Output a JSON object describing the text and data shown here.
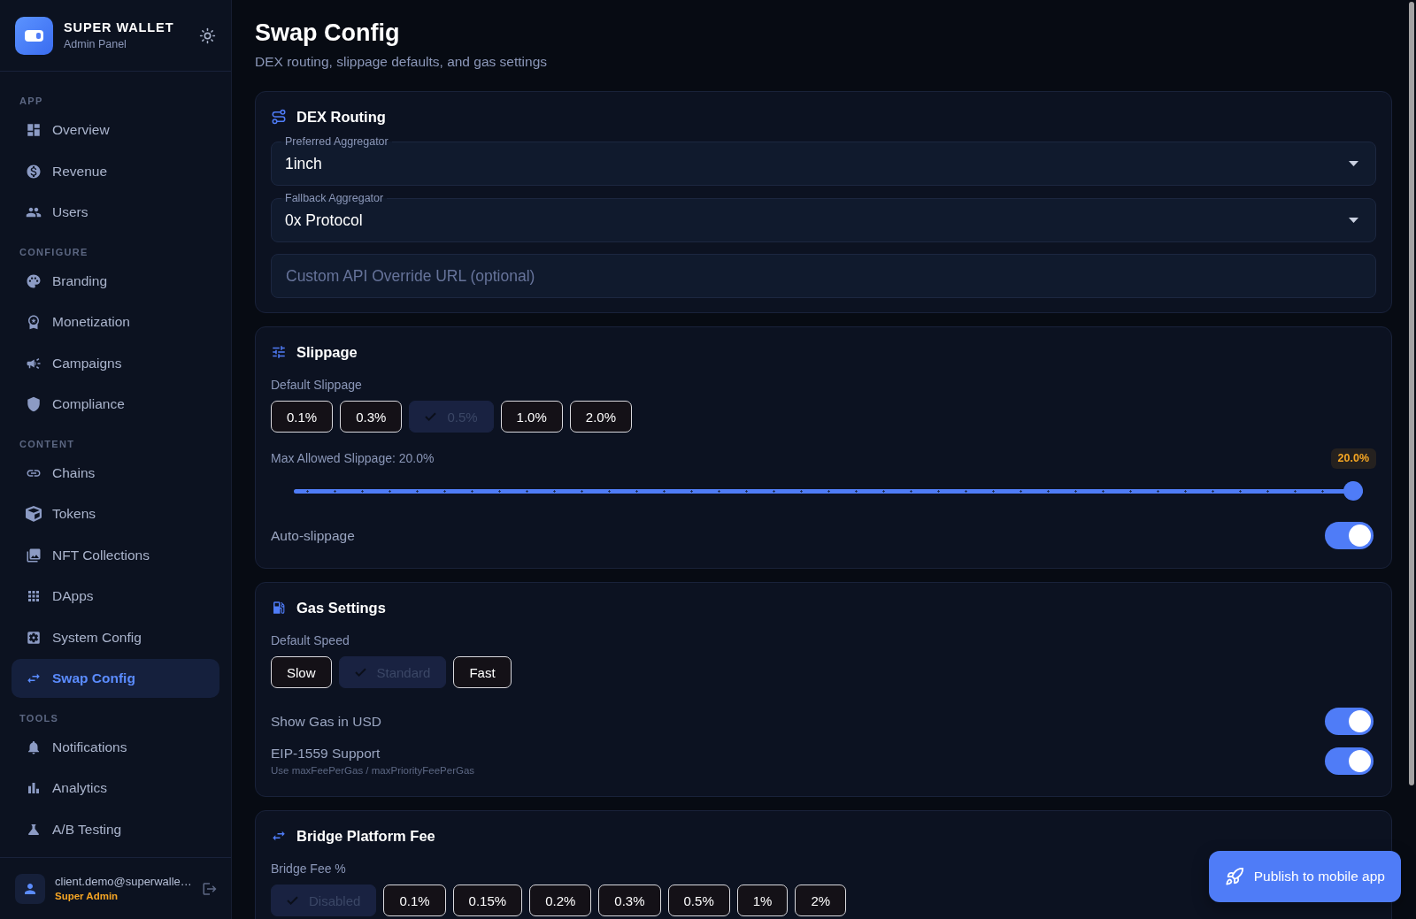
{
  "sidebar": {
    "brand": {
      "title": "SUPER WALLET",
      "subtitle": "Admin Panel"
    },
    "sections": [
      {
        "label": "APP",
        "items": [
          {
            "label": "Overview",
            "selected": false
          },
          {
            "label": "Revenue",
            "selected": false
          },
          {
            "label": "Users",
            "selected": false
          }
        ]
      },
      {
        "label": "CONFIGURE",
        "items": [
          {
            "label": "Branding",
            "selected": false
          },
          {
            "label": "Monetization",
            "selected": false
          },
          {
            "label": "Campaigns",
            "selected": false
          },
          {
            "label": "Compliance",
            "selected": false
          }
        ]
      },
      {
        "label": "CONTENT",
        "items": [
          {
            "label": "Chains",
            "selected": false
          },
          {
            "label": "Tokens",
            "selected": false
          },
          {
            "label": "NFT Collections",
            "selected": false
          },
          {
            "label": "DApps",
            "selected": false
          },
          {
            "label": "System Config",
            "selected": false
          },
          {
            "label": "Swap Config",
            "selected": true
          }
        ]
      },
      {
        "label": "TOOLS",
        "items": [
          {
            "label": "Notifications",
            "selected": false
          },
          {
            "label": "Analytics",
            "selected": false
          },
          {
            "label": "A/B Testing",
            "selected": false
          }
        ]
      }
    ],
    "user": {
      "email": "client.demo@superwalle…",
      "role": "Super Admin"
    }
  },
  "page": {
    "title": "Swap Config",
    "subtitle": "DEX routing, slippage defaults, and gas settings"
  },
  "cards": [
    {
      "title": "DEX Routing",
      "rows": [
        {
          "kind": "select",
          "label": "Preferred Aggregator",
          "value": "1inch"
        },
        {
          "kind": "select",
          "label": "Fallback Aggregator",
          "value": "0x Protocol"
        },
        {
          "kind": "input",
          "placeholder": "Custom API Override URL (optional)"
        }
      ]
    },
    {
      "title": "Slippage",
      "rows": [
        {
          "kind": "chips",
          "label": "Default Slippage",
          "options": [
            {
              "label": "0.1%",
              "selected": false
            },
            {
              "label": "0.3%",
              "selected": false
            },
            {
              "label": "0.5%",
              "selected": true
            },
            {
              "label": "1.0%",
              "selected": false
            },
            {
              "label": "2.0%",
              "selected": false
            }
          ]
        },
        {
          "kind": "slider",
          "label": "Max Allowed Slippage: 20.0%",
          "reading": "20.0%",
          "level": 1
        },
        {
          "kind": "toggle",
          "label": "Auto-slippage",
          "on": true
        }
      ]
    },
    {
      "title": "Gas Settings",
      "rows": [
        {
          "kind": "chips",
          "label": "Default Speed",
          "options": [
            {
              "label": "Slow",
              "selected": false
            },
            {
              "label": "Standard",
              "selected": true
            },
            {
              "label": "Fast",
              "selected": false
            }
          ]
        },
        {
          "kind": "toggle",
          "label": "Show Gas in USD",
          "on": true
        },
        {
          "kind": "toggle",
          "label": "EIP-1559 Support",
          "hint": "Use maxFeePerGas / maxPriorityFeePerGas",
          "on": true
        }
      ]
    },
    {
      "title": "Bridge Platform Fee",
      "rows": [
        {
          "kind": "chips",
          "label": "Bridge Fee %",
          "options": [
            {
              "label": "Disabled",
              "selected": true
            },
            {
              "label": "0.1%",
              "selected": false
            },
            {
              "label": "0.15%",
              "selected": false
            },
            {
              "label": "0.2%",
              "selected": false
            },
            {
              "label": "0.3%",
              "selected": false
            },
            {
              "label": "0.5%",
              "selected": false
            },
            {
              "label": "1%",
              "selected": false
            },
            {
              "label": "2%",
              "selected": false
            }
          ]
        }
      ]
    }
  ],
  "publish_button": {
    "label": "Publish to mobile app"
  }
}
